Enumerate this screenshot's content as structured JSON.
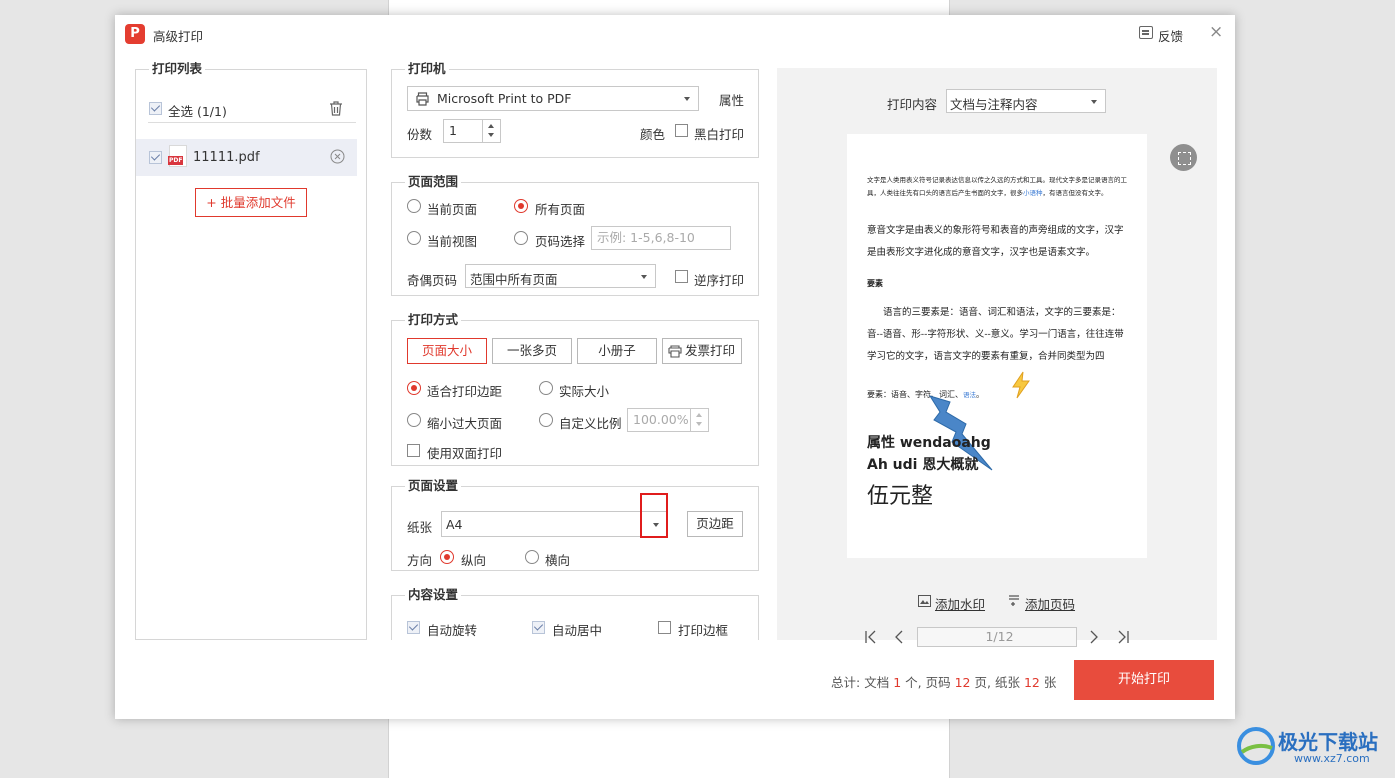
{
  "dialog": {
    "title": "高级打印",
    "feedback": "反馈",
    "close": "×"
  },
  "print_list": {
    "legend": "打印列表",
    "select_all": "全选 (1/1)",
    "file_badge": "PDF",
    "file_name": "11111.pdf",
    "add_files": "+ 批量添加文件"
  },
  "printer": {
    "legend": "打印机",
    "name": "Microsoft Print to PDF",
    "properties": "属性",
    "copies_label": "份数",
    "copies": "1",
    "color_label": "颜色",
    "bw_print": "黑白打印"
  },
  "page_range": {
    "legend": "页面范围",
    "current_page": "当前页面",
    "all_pages": "所有页面",
    "current_view": "当前视图",
    "page_select": "页码选择",
    "page_select_placeholder": "示例: 1-5,6,8-10",
    "odd_even_label": "奇偶页码",
    "odd_even_value": "范围中所有页面",
    "reverse": "逆序打印",
    "selected": "所有页面"
  },
  "print_mode": {
    "legend": "打印方式",
    "buttons": [
      "页面大小",
      "一张多页",
      "小册子",
      "发票打印"
    ],
    "active": "页面大小",
    "fit_margin": "适合打印边距",
    "actual_size": "实际大小",
    "shrink": "缩小过大页面",
    "custom_scale": "自定义比例",
    "scale_value": "100.00%",
    "duplex": "使用双面打印"
  },
  "page_setup": {
    "legend": "页面设置",
    "paper_label": "纸张",
    "paper_value": "A4",
    "margins": "页边距",
    "orientation_label": "方向",
    "portrait": "纵向",
    "landscape": "横向"
  },
  "content_setup": {
    "legend": "内容设置",
    "auto_rotate": "自动旋转",
    "auto_center": "自动居中",
    "print_border": "打印边框"
  },
  "preview": {
    "content_label": "打印内容",
    "content_value": "文档与注释内容",
    "add_watermark": "添加水印",
    "add_page_number": "添加页码",
    "page_indicator": "1/12",
    "doc": {
      "para1_a": "文字是人类用表义符号记录表达信息以传之久远的方式和工具。现代文字多是记录语言的工具，人类往往先有口头的语言后产生书面的文字，很多",
      "para1_link": "小语种",
      "para1_b": "，有语言但没有文字。",
      "para2": "意音文字是由表义的象形符号和表音的声旁组成的文字，汉字是由表形文字进化成的意音文字，汉字也是语素文字。",
      "heading": "要素",
      "para3": "语言的三要素是：语音、词汇和语法，文字的三要素是：音--语音、形--字符形状、义--意义。学习一门语言，往往连带学习它的文字，语言文字的要素有重复，合并同类型为四",
      "para4_a": "要素：语音、字符、词汇、",
      "para4_link": "语法",
      "para4_b": "。",
      "bold1": "属性 wendaoahg",
      "bold2": "Ah udi 恩大概就",
      "big": "伍元整"
    }
  },
  "footer": {
    "total": "总计:",
    "doc_label": "文档",
    "doc_count": "1",
    "doc_unit": "个,",
    "page_label": "页码",
    "page_count": "12",
    "page_unit": "页,",
    "paper_label": "纸张",
    "paper_count": "12",
    "paper_unit": "张",
    "start": "开始打印"
  },
  "colors": {
    "accent": "#e84c3d",
    "highlight": "#e01c1c",
    "link": "#3b7bd4"
  },
  "watermark": {
    "main": "极光下载站",
    "url": "www.xz7.com"
  }
}
